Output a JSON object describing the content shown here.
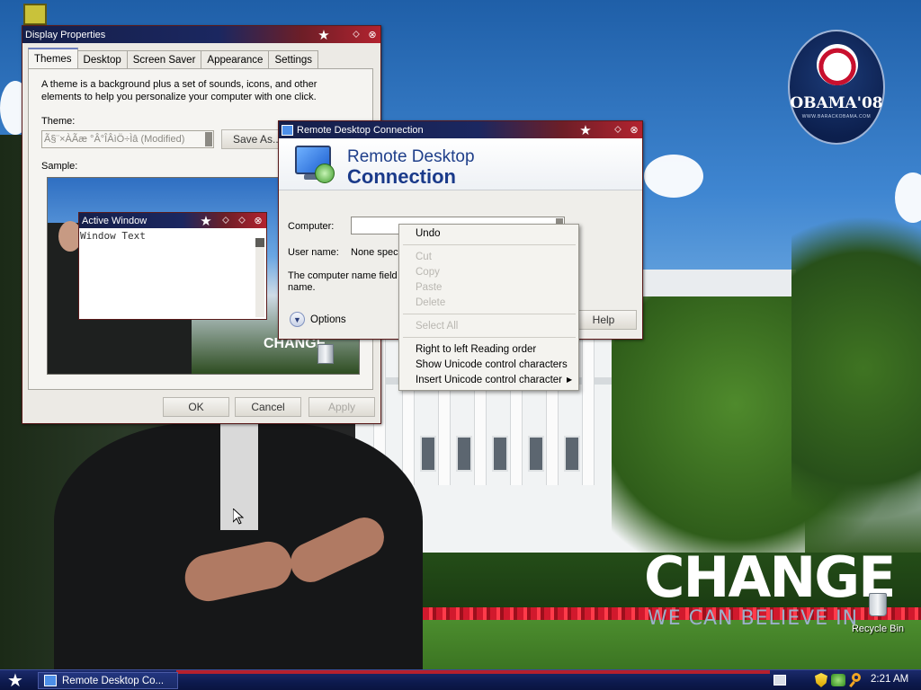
{
  "display_properties": {
    "title": "Display Properties",
    "tabs": [
      "Themes",
      "Desktop",
      "Screen Saver",
      "Appearance",
      "Settings"
    ],
    "active_tab": "Themes",
    "description": "A theme is a background plus a set of sounds, icons, and other elements to help you personalize your computer with one click.",
    "theme_label": "Theme:",
    "theme_value": "Ã§¨×ÀÃæ °Â°ÎÂìÖ÷Ìâ (Modified)",
    "save_as_label": "Save As...",
    "sample_label": "Sample:",
    "active_window_title": "Active Window",
    "window_text": "Window Text",
    "sample_change": "CHANGE",
    "ok_label": "OK",
    "cancel_label": "Cancel",
    "apply_label": "Apply"
  },
  "remote_desktop": {
    "title": "Remote Desktop Connection",
    "header_line1": "Remote Desktop",
    "header_line2": "Connection",
    "computer_label": "Computer:",
    "computer_value": "",
    "username_label": "User name:",
    "username_value": "None speci",
    "note": "The computer name field is",
    "note2": "name.",
    "options_label": "Options",
    "help_label": "Help"
  },
  "context_menu": {
    "items": [
      "Undo",
      "Cut",
      "Copy",
      "Paste",
      "Delete",
      "Select All",
      "Right to left Reading order",
      "Show Unicode control characters",
      "Insert Unicode control character"
    ]
  },
  "desktop": {
    "change_text": "CHANGE",
    "believe_text": "WE CAN BELIEVE IN",
    "obama_text": "OBAMA'08",
    "obama_sub": "WWW.BARACKOBAMA.COM",
    "recycle_bin": "Recycle Bin"
  },
  "taskbar": {
    "task_label": "Remote Desktop Co...",
    "clock": "2:21 AM"
  },
  "colors": {
    "title_blue": "#1b2760",
    "title_red": "#b3232f",
    "rdc_blue": "#1a3a8a"
  }
}
